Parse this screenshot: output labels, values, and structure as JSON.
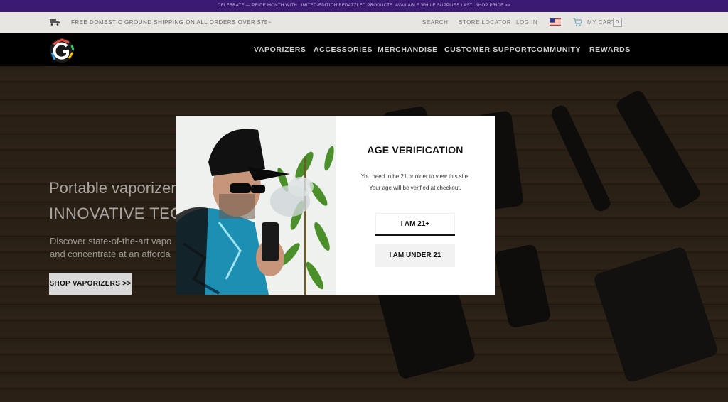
{
  "promo": {
    "text": "CELEBRATE — PRIDE MONTH WITH LIMITED-EDITION BEDAZZLED PRODUCTS. AVAILABLE WHILE SUPPLIES LAST! SHOP PRIDE >>"
  },
  "utility": {
    "shipping_text": "FREE DOMESTIC GROUND SHIPPING ON ALL ORDERS OVER $75~",
    "search": "SEARCH",
    "store_locator": "STORE LOCATOR",
    "login": "LOG IN",
    "cart": "MY CART",
    "cart_count": "0"
  },
  "nav": {
    "items": [
      "VAPORIZERS",
      "ACCESSORIES",
      "MERCHANDISE",
      "CUSTOMER SUPPORT",
      "COMMUNITY",
      "REWARDS"
    ]
  },
  "hero": {
    "title_line1": "Portable vaporizers",
    "title_line2": "INNOVATIVE TECHN",
    "desc_line1": "Discover state-of-the-art vapo",
    "desc_line2": "and concentrate at an afforda",
    "cta": "SHOP VAPORIZERS >>"
  },
  "modal": {
    "title": "AGE VERIFICATION",
    "message_line1": "You need to be 21 or older to view this site.",
    "message_line2": "Your age will be verified at checkout.",
    "confirm_button": "I AM 21+",
    "deny_button": "I AM UNDER 21"
  },
  "colors": {
    "promo_bg": "#3a1a73",
    "utility_bg": "#e7e6e3",
    "nav_bg": "#000000",
    "modal_bg": "#ffffff"
  }
}
